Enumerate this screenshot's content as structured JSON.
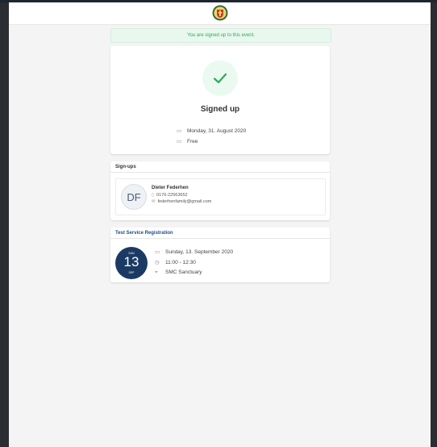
{
  "alert": {
    "text": "You are signed up to this event."
  },
  "signed": {
    "title": "Signed up",
    "date": "Monday, 31. August 2020",
    "price": "Free"
  },
  "signups": {
    "heading": "Sign-ups",
    "person": {
      "initials": "DF",
      "name": "Dieter Federhen",
      "phone": "0176-22563652",
      "email": "federhenfamily@gmail.com"
    }
  },
  "event": {
    "heading": "Test Service Registration",
    "badge": {
      "weekday": "SUN",
      "day": "13",
      "month": "SEP"
    },
    "date": "Sunday, 13. September 2020",
    "time": "11:00 - 12:30",
    "location": "SMC Sanctuary"
  },
  "colors": {
    "success": "#2faa5a",
    "brand_blue": "#1b3a63",
    "heading_blue": "#1e4e8c"
  },
  "icons": [
    "crest-logo",
    "check-icon",
    "calendar-icon",
    "ticket-icon",
    "phone-icon",
    "mail-icon",
    "clock-icon",
    "location-pin-icon"
  ]
}
